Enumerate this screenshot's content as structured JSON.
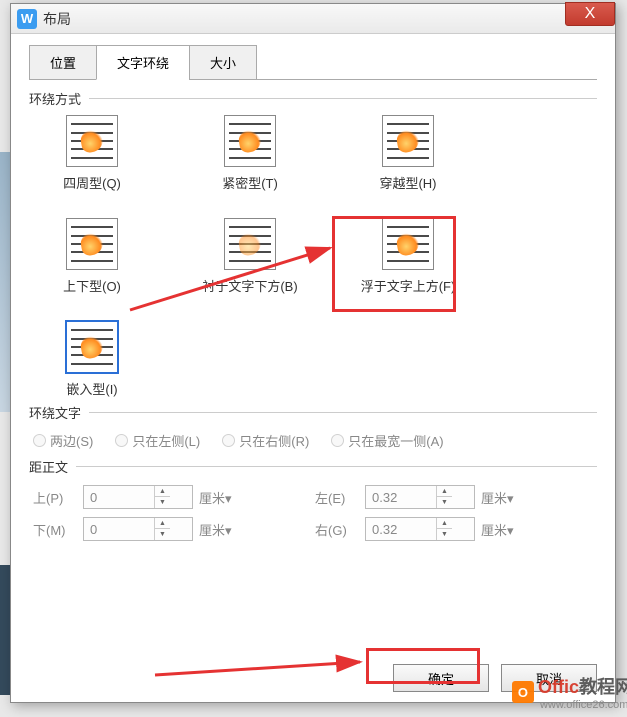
{
  "window": {
    "title": "布局",
    "close": "X",
    "app_icon_letter": "W"
  },
  "tabs": {
    "position": "位置",
    "wrap": "文字环绕",
    "size": "大小"
  },
  "sections": {
    "wrap_style": "环绕方式",
    "wrap_text": "环绕文字",
    "distance": "距正文"
  },
  "wrap_options": [
    {
      "label": "四周型(Q)"
    },
    {
      "label": "紧密型(T)"
    },
    {
      "label": "穿越型(H)"
    },
    {
      "label": "上下型(O)"
    },
    {
      "label": "衬于文字下方(B)"
    },
    {
      "label": "浮于文字上方(F)"
    },
    {
      "label": "嵌入型(I)",
      "selected": true
    }
  ],
  "wrap_text_options": {
    "both": "两边(S)",
    "left": "只在左侧(L)",
    "right": "只在右侧(R)",
    "widest": "只在最宽一侧(A)"
  },
  "distance": {
    "top_label": "上(P)",
    "bottom_label": "下(M)",
    "left_label": "左(E)",
    "right_label": "右(G)",
    "top_value": "0",
    "bottom_value": "0",
    "left_value": "0.32",
    "right_value": "0.32",
    "unit": "厘米"
  },
  "buttons": {
    "ok": "确定",
    "cancel": "取消"
  },
  "watermark": {
    "icon_letter": "O",
    "text1": "Offic",
    "text2": "教程网",
    "sub": "www.office26.com"
  }
}
